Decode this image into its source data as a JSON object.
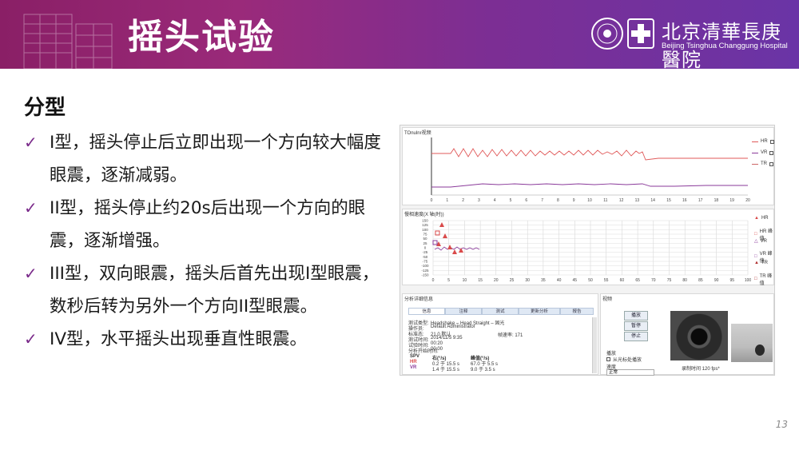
{
  "header": {
    "title": "摇头试验",
    "hospital_cn": "北京清華長庚醫院",
    "hospital_en": "Beijing Tsinghua Changgung Hospital"
  },
  "subtitle": "分型",
  "items": [
    "I型，摇头停止后立即出现一个方向较大幅度眼震，逐渐减弱。",
    "II型，摇头停止约20s后出现一个方向的眼震，逐渐增强。",
    "III型，双向眼震，摇头后首先出现I型眼震，数秒后转为另外一个方向II型眼震。",
    "IV型，水平摇头出现垂直性眼震。"
  ],
  "app": {
    "top_panel_title": "TOnulnr视频",
    "mid_panel_title": "慢相速度(X 轴(时))",
    "top_legend": [
      "HR",
      "VR",
      "TR"
    ],
    "mid_legend": [
      "HR",
      "HR 峰值",
      "VR",
      "VR 峰值",
      "TR",
      "TR 峰值"
    ],
    "x_ticks_top": [
      "0",
      "1",
      "2",
      "3",
      "4",
      "5",
      "6",
      "7",
      "8",
      "9",
      "10",
      "11",
      "12",
      "13",
      "14",
      "15",
      "16",
      "17",
      "18",
      "19",
      "20"
    ],
    "x_ticks_mid": [
      "0",
      "5",
      "10",
      "15",
      "20",
      "25",
      "30",
      "35",
      "40",
      "45",
      "50",
      "55",
      "60",
      "65",
      "70",
      "75",
      "80",
      "85",
      "90",
      "95",
      "100"
    ],
    "y_ticks_mid": [
      "150",
      "125",
      "100",
      "75",
      "50",
      "25",
      "0",
      "-25",
      "-50",
      "-75",
      "-100",
      "-125",
      "-150"
    ],
    "info_panel_title": "分析详细信息",
    "tabs": [
      "信息",
      "注释",
      "测试",
      "更新分析",
      "报告"
    ],
    "info_labels": [
      "测试类型:",
      "操作员:",
      "标准态:",
      "测试时间:",
      "试验时间:",
      "分析开始时间:"
    ],
    "info_values": [
      "Headshake – Head Straight – 固光",
      "Default Administrator",
      "21.0 默认",
      "2014/11/5 9:35",
      "00:20",
      "00:00"
    ],
    "frame_rate": "帧速率: 171",
    "spv_header": [
      "SPV",
      "右(°/s)",
      "峰值(°/s)"
    ],
    "spv_rows": [
      {
        "name": "HR",
        "right": "0.2 于 15.5 s",
        "peak": "67.0 于 5.5 s"
      },
      {
        "name": "VR",
        "right": "1.4 于 15.5 s",
        "peak": "9.0 于 3.5 s"
      }
    ],
    "video_panel_title": "视频",
    "buttons": [
      "播放",
      "暂停",
      "停止"
    ],
    "playback_label": "播放",
    "playback_option": "从光标处播放",
    "speed_label": "速度",
    "speed_value": "正常",
    "video_caption": "录制时间 120 fps*"
  },
  "page_number": "13",
  "colors": {
    "accent": "#7a2a8a",
    "banner_left": "#8a1f66",
    "banner_right": "#6a34a6",
    "hr_trace": "#e05a5a",
    "vr_trace": "#8a3a9a"
  }
}
